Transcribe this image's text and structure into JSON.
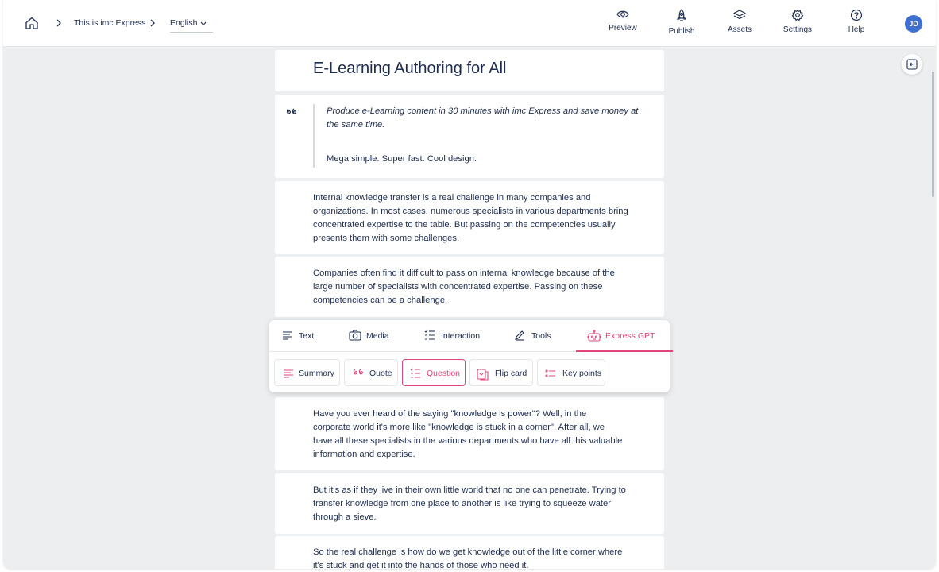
{
  "breadcrumb": {
    "course": "This is imc Express",
    "language": "English"
  },
  "actions": [
    {
      "id": "preview",
      "label": "Preview",
      "icon": "eye-icon"
    },
    {
      "id": "publish",
      "label": "Publish",
      "icon": "rocket-icon"
    },
    {
      "id": "assets",
      "label": "Assets",
      "icon": "layers-icon"
    },
    {
      "id": "settings",
      "label": "Settings",
      "icon": "gear-icon"
    },
    {
      "id": "help",
      "label": "Help",
      "icon": "help-circle-icon"
    }
  ],
  "user": {
    "initials": "JD"
  },
  "colors": {
    "accent": "#e0457b",
    "text": "#1f2d4e",
    "avatar": "#3f6fd0",
    "background": "#eceef0"
  },
  "content": {
    "title": "E-Learning Authoring for All",
    "quote": {
      "text": "Produce e-Learning content in 30 minutes with imc Express and save money at the same time.",
      "subtitle": "Mega simple. Super fast. Cool design."
    },
    "paragraphs": [
      "Internal knowledge transfer is a real challenge in many companies and organizations. In most cases, numerous specialists in various departments bring concentrated expertise to the table. But passing on the competencies usually presents them with some challenges.",
      "Companies often find it difficult to pass on internal knowledge because of the large number of specialists with concentrated expertise. Passing on these competencies can be a challenge.",
      "Have you ever heard of the saying \"knowledge is power\"? Well, in the corporate world it's more like \"knowledge is stuck in a corner\". After all, we have all these specialists in the various departments who have all this valuable information and expertise.",
      "But it's as if they live in their own little world that no one can penetrate. Trying to transfer knowledge from one place to another is like trying to squeeze water through a sieve.",
      "So the real challenge is how do we get knowledge out of the little corner where it's stuck and get it into the hands of those who need it."
    ]
  },
  "toolbar": {
    "tabs": [
      {
        "label": "Text",
        "icon": "text-lines-icon"
      },
      {
        "label": "Media",
        "icon": "camera-icon"
      },
      {
        "label": "Interaction",
        "icon": "checklist-icon"
      },
      {
        "label": "Tools",
        "icon": "pencil-icon"
      },
      {
        "label": "Express GPT",
        "icon": "robot-icon",
        "active": true
      }
    ],
    "chips": [
      {
        "label": "Summary",
        "icon": "summary-icon"
      },
      {
        "label": "Quote",
        "icon": "quote-icon"
      },
      {
        "label": "Question",
        "icon": "question-list-icon",
        "active": true
      },
      {
        "label": "Flip card",
        "icon": "flip-card-icon"
      },
      {
        "label": "Key points",
        "icon": "key-points-icon"
      }
    ]
  }
}
